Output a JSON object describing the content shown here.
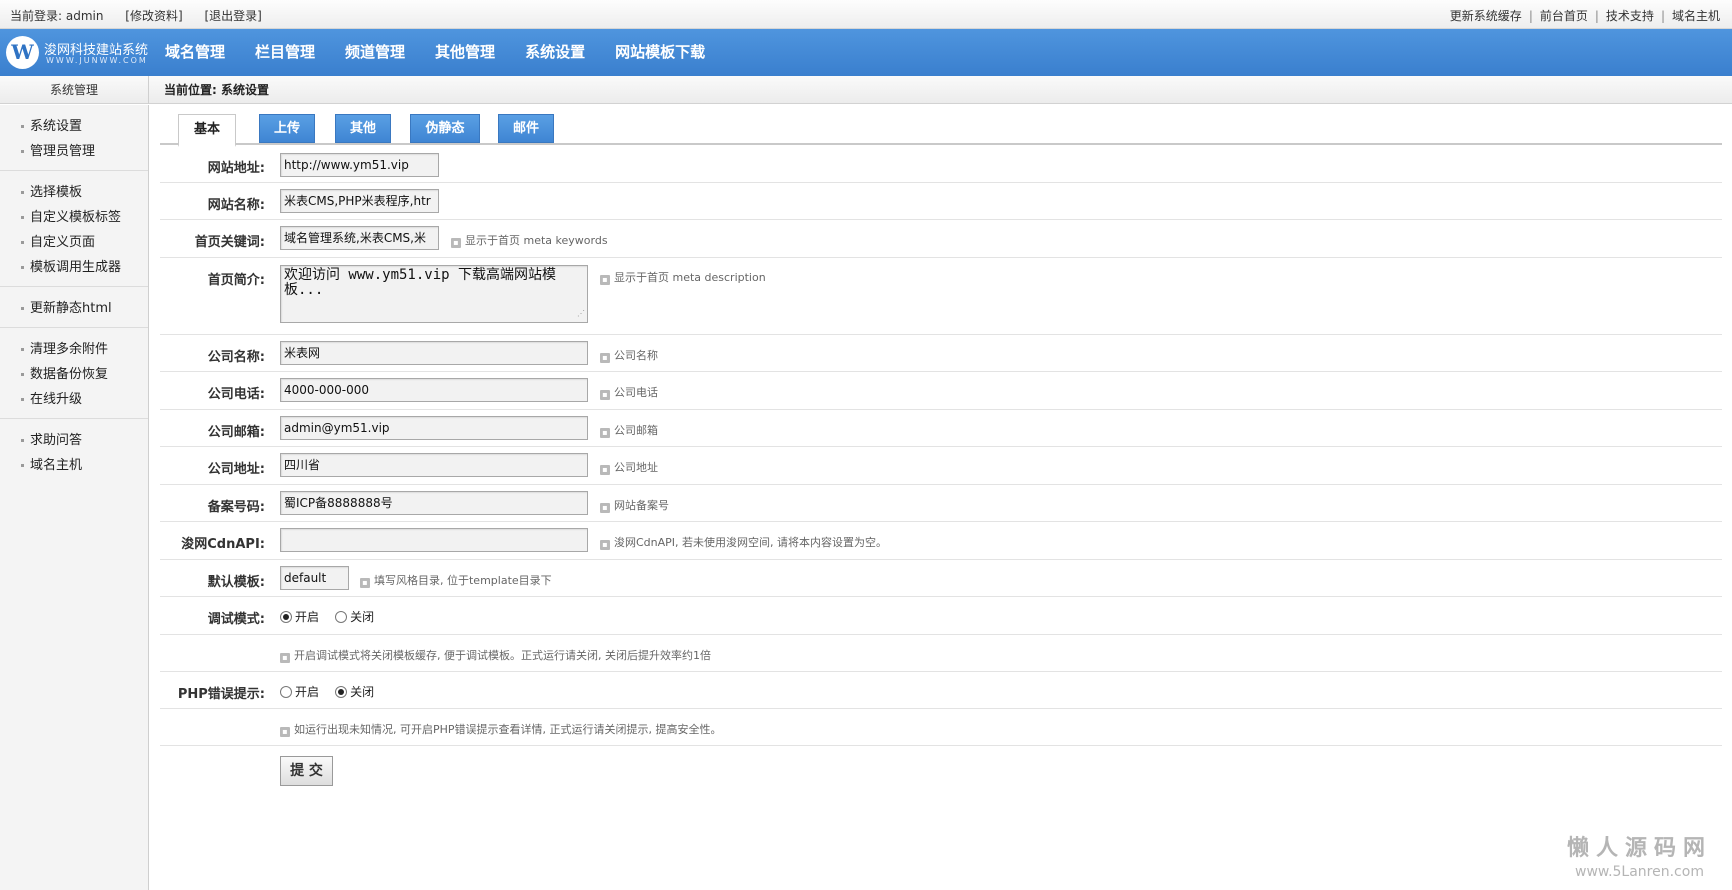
{
  "topbar": {
    "login_label": "当前登录: admin",
    "edit_profile": "[修改资料]",
    "logout": "[退出登录]",
    "links": [
      "更新系统缓存",
      "前台首页",
      "技术支持",
      "域名主机"
    ]
  },
  "header": {
    "logo_text": "浚网科技建站系统",
    "logo_sub": "WWW.JUNWW.COM",
    "logo_mark": "W",
    "nav": [
      "域名管理",
      "栏目管理",
      "频道管理",
      "其他管理",
      "系统设置",
      "网站模板下载"
    ]
  },
  "subbar": {
    "side_title": "系统管理",
    "breadcrumb": "当前位置: 系统设置"
  },
  "sidebar": {
    "groups": [
      [
        "系统设置",
        "管理员管理"
      ],
      [
        "选择模板",
        "自定义模板标签",
        "自定义页面",
        "模板调用生成器"
      ],
      [
        "更新静态html"
      ],
      [
        "清理多余附件",
        "数据备份恢复",
        "在线升级"
      ],
      [
        "求助问答",
        "域名主机"
      ]
    ]
  },
  "tabs": [
    "基本",
    "上传",
    "其他",
    "伪静态",
    "邮件"
  ],
  "form": {
    "site_url": {
      "label": "网站地址:",
      "value": "http://www.ym51.vip"
    },
    "site_name": {
      "label": "网站名称:",
      "value": "米表CMS,PHP米表程序,htr"
    },
    "keywords": {
      "label": "首页关键词:",
      "value": "域名管理系统,米表CMS,米",
      "hint": "显示于首页 meta keywords"
    },
    "description": {
      "label": "首页简介:",
      "value": "欢迎访问 www.ym51.vip 下载高端网站模板...",
      "hint": "显示于首页 meta description"
    },
    "company_name": {
      "label": "公司名称:",
      "value": "米表网",
      "hint": "公司名称"
    },
    "company_phone": {
      "label": "公司电话:",
      "value": "4000-000-000",
      "hint": "公司电话"
    },
    "company_email": {
      "label": "公司邮箱:",
      "value": "admin@ym51.vip",
      "hint": "公司邮箱"
    },
    "company_address": {
      "label": "公司地址:",
      "value": "四川省",
      "hint": "公司地址"
    },
    "icp": {
      "label": "备案号码:",
      "value": "蜀ICP备8888888号",
      "hint": "网站备案号"
    },
    "cdn_api": {
      "label": "浚网CdnAPI:",
      "value": "",
      "hint": "浚网CdnAPI, 若未使用浚网空间, 请将本内容设置为空。"
    },
    "template": {
      "label": "默认模板:",
      "value": "default",
      "hint": "填写风格目录, 位于template目录下"
    },
    "debug": {
      "label": "调试模式:",
      "on_label": "开启",
      "off_label": "关闭",
      "selected": "on",
      "hint": "开启调试模式将关闭模板缓存, 便于调试模板。正式运行请关闭, 关闭后提升效率约1倍"
    },
    "php_error": {
      "label": "PHP错误提示:",
      "on_label": "开启",
      "off_label": "关闭",
      "selected": "off",
      "hint": "如运行出现未知情况, 可开启PHP错误提示查看详情, 正式运行请关闭提示, 提高安全性。"
    },
    "submit_label": "提 交"
  },
  "watermark": {
    "line1": "懒人源码网",
    "line2": "www.5Lanren.com"
  }
}
